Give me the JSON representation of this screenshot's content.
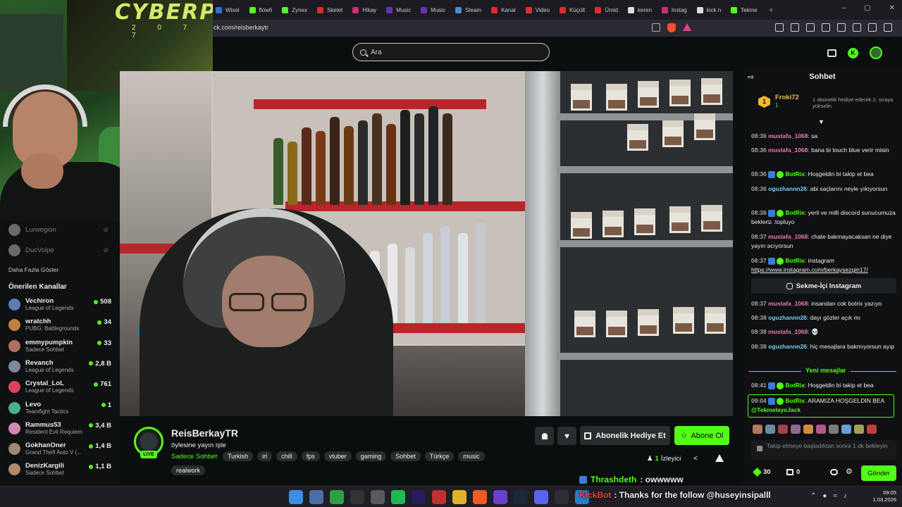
{
  "browser": {
    "tabs": [
      {
        "label": "Wisel",
        "color": "#2f6fd6"
      },
      {
        "label": "flow6",
        "color": "#53fc18"
      },
      {
        "label": "Zynex",
        "color": "#53fc18"
      },
      {
        "label": "Skelet",
        "color": "#e22c2c"
      },
      {
        "label": "Hikay",
        "color": "#d62976"
      },
      {
        "label": "Music",
        "color": "#6b2fb3"
      },
      {
        "label": "Music",
        "color": "#6b2fb3"
      },
      {
        "label": "Steam",
        "color": "#4e8acb"
      },
      {
        "label": "Kanal",
        "color": "#e22c2c"
      },
      {
        "label": "Video",
        "color": "#e22c2c"
      },
      {
        "label": "Küçült",
        "color": "#e22c2c"
      },
      {
        "label": "Ümid",
        "color": "#e22c2c"
      },
      {
        "label": "keren",
        "color": "#dddddd"
      },
      {
        "label": "Instag",
        "color": "#d62976"
      },
      {
        "label": "kick n",
        "color": "#dddddd"
      },
      {
        "label": "Tekme",
        "color": "#53fc18"
      }
    ],
    "new_tab": "+",
    "window_controls": [
      "–",
      "▢",
      "✕"
    ],
    "url": "ck.com/reisberkaytr"
  },
  "header": {
    "search_placeholder": "Ara"
  },
  "webcam": {
    "poster_text": "CYBERPUNK",
    "poster_nums": "2 0 7 7"
  },
  "sidebar": {
    "offline": [
      {
        "name": "Lurwegion",
        "color": "#6a6a6a"
      },
      {
        "name": "DucVolpe",
        "color": "#6a6a6a"
      }
    ],
    "show_more": "Daha Fazla Göster",
    "recommended_title": "Önerilen Kanallar",
    "channels": [
      {
        "name": "Vechiron",
        "game": "League of Legends",
        "count": "508",
        "color": "#5a7fb0"
      },
      {
        "name": "wratchh",
        "game": "PUBG: Battlegrounds",
        "count": "34",
        "color": "#c08040"
      },
      {
        "name": "emmypumpkin",
        "game": "Sadece Sohbet",
        "count": "33",
        "color": "#b07060"
      },
      {
        "name": "Revanch",
        "game": "League of Legends",
        "count": "2,8 B",
        "color": "#7a8a9a"
      },
      {
        "name": "Crystal_LoL",
        "game": "League of Legends",
        "count": "761",
        "color": "#e04060"
      },
      {
        "name": "Levo",
        "game": "Teamfight Tactics",
        "count": "1",
        "color": "#4ab08a"
      },
      {
        "name": "Rammus53",
        "game": "Resident Evil Requiem",
        "count": "3,4 B",
        "color": "#d08ab0"
      },
      {
        "name": "GokhanOner",
        "game": "Grand Theft Auto V (...",
        "count": "1,4 B",
        "color": "#9a8a70"
      },
      {
        "name": "DenizKargili",
        "game": "Sadece Sohbet",
        "count": "1,1 B",
        "color": "#b08a6a"
      }
    ]
  },
  "stream": {
    "channel_name": "ReisBerkayTR",
    "live_label": "LIVE",
    "title": "öylesine yayın işte",
    "category": "Sadece Sohbet",
    "tags": [
      "Turkish",
      "irl",
      "chill",
      "fps",
      "vtuber",
      "gaming",
      "Sohbet",
      "Türkçe",
      "music"
    ],
    "tags_row2": [
      "realwork"
    ],
    "gift_label": "Abonelik Hediye Et",
    "subscribe_label": "Abone Ol",
    "viewers_count": "1",
    "viewers_label": "İzleyici"
  },
  "overlay": {
    "alert1_name": "Thrashdeth",
    "alert1_text": ": owwwww",
    "alert2_name": "KickBot",
    "alert2_text": ": Thanks for the follow @huseyinsipalll"
  },
  "chat": {
    "title": "Sohbet",
    "pinned_rank": "1",
    "pinned_user": "Froki72",
    "pinned_count": "1",
    "pinned_text": "1 abonelik hediye ederek 2. sıraya yükseli̇n",
    "messages": [
      {
        "time": "08:36",
        "user": "mustafa_1068",
        "text": "sa"
      },
      {
        "time": "08:36",
        "user": "mustafa_1068",
        "text": "bana bi touch blue verir misin"
      },
      {
        "time": "08:36",
        "user": "BotRix",
        "text": "Hoşgeldin bi takip et bea"
      },
      {
        "time": "08:36",
        "user": "oguzhannn26",
        "text": "abi saçlarını neyle yıkıyorsun"
      },
      {
        "time": "08:36",
        "user": "BotRix",
        "text": "yerli ve milli discord sunucumuza bekleriz :topluyo"
      },
      {
        "time": "08:37",
        "user": "mustafa_1068",
        "text": "chate bakmayacaksan ne diye yayın acıyorsun"
      },
      {
        "time": "08:37",
        "user": "BotRix",
        "text": "instagram",
        "link": "https://www.instagram.com/berkaysezgin17/"
      },
      {
        "time": "08:37",
        "user": "mustafa_1068",
        "text": "insandan cok botrix yazıyo"
      },
      {
        "time": "08:38",
        "user": "oguzhannn26",
        "text": "dayı gözler açık mı"
      },
      {
        "time": "08:38",
        "user": "mustafa_1068",
        "text": "💀"
      },
      {
        "time": "08:38",
        "user": "oguzhannn26",
        "text": "hiç mesajlara bakmıyorsun ayıp"
      },
      {
        "time": "08:41",
        "user": "BotRix",
        "text": "Hoşgeldin bi takip et bea"
      },
      {
        "time": "09:04",
        "user": "BotRix",
        "text": "ARAMIZA HOŞGELDİN BEA",
        "mention": "@TekmeleyeJack"
      }
    ],
    "insta_button": "Sekme-İçi Instagram",
    "new_messages": "Yeni mesajlar",
    "input_placeholder": "Takip etmeye başladıktan sonra 1 dk bekleyin",
    "points": "30",
    "chest": "0",
    "send_label": "Gönder"
  },
  "taskbar": {
    "time": "09:05",
    "date": "1.03.2026"
  }
}
